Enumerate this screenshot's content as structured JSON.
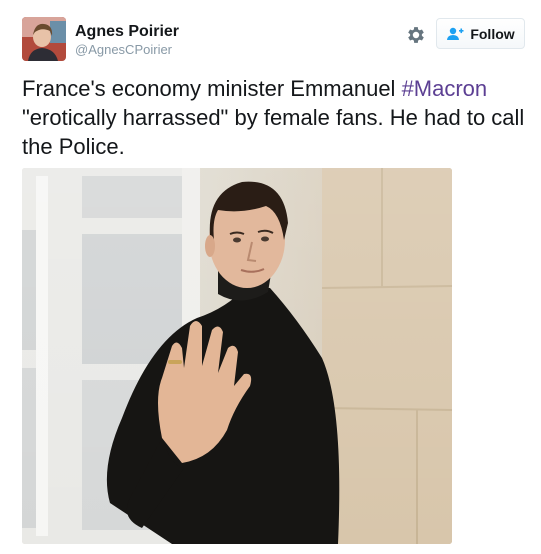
{
  "tweet": {
    "author": {
      "name": "Agnes Poirier",
      "handle": "@AgnesCPoirier"
    },
    "follow_label": "Follow",
    "text_before": "France's economy minister Emmanuel ",
    "hashtag": "#Macron",
    "text_after": " \"erotically harrassed\" by female fans. He had to call the Police."
  },
  "colors": {
    "hashtag": "#5c3f93",
    "handle": "#8899a6",
    "follow_icon": "#1da1f2"
  },
  "icons": {
    "settings": "gear-icon",
    "follow": "add-user-icon"
  }
}
